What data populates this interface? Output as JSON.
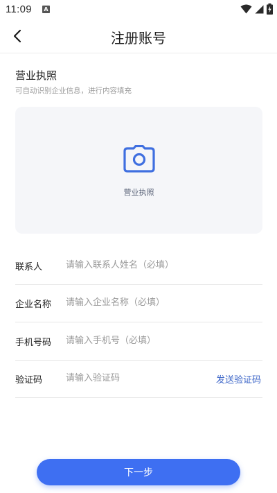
{
  "status_bar": {
    "time": "11:09",
    "icons": [
      "a-notification-icon",
      "wifi-icon",
      "signal-icon",
      "battery-charging-icon"
    ]
  },
  "nav": {
    "title": "注册账号",
    "back_icon": "chevron-left-icon"
  },
  "license": {
    "title": "营业执照",
    "subtitle": "可自动识别企业信息，进行内容填充",
    "upload_label": "营业执照",
    "upload_icon": "camera-icon"
  },
  "form": {
    "contact": {
      "label": "联系人",
      "placeholder": "请输入联系人姓名（必填）",
      "value": ""
    },
    "company": {
      "label": "企业名称",
      "placeholder": "请输入企业名称（必填）",
      "value": ""
    },
    "phone": {
      "label": "手机号码",
      "placeholder": "请输入手机号（必填）",
      "value": ""
    },
    "code": {
      "label": "验证码",
      "placeholder": "请输入验证码",
      "value": "",
      "send_label": "发送验证码"
    }
  },
  "next_button": "下一步",
  "colors": {
    "primary": "#3e6ff2",
    "icon_blue": "#3f6fe0",
    "link": "#3d66c8",
    "upload_bg": "#f5f6f9"
  }
}
